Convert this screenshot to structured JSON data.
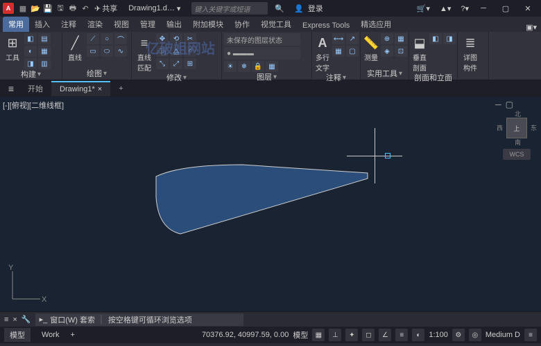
{
  "titlebar": {
    "app_letter": "A",
    "share": "共享",
    "doc_title": "Drawing1.d…",
    "search_placeholder": "键入关键字或短语",
    "login": "登录"
  },
  "ribbon_tabs": [
    "常用",
    "插入",
    "注释",
    "渲染",
    "视图",
    "管理",
    "输出",
    "附加模块",
    "协作",
    "视觉工具",
    "Express Tools",
    "精选应用"
  ],
  "panels": {
    "p0": {
      "label": "构建",
      "btn1": "工具",
      "btn2": ""
    },
    "p1": {
      "label": "绘图",
      "btn": "直线"
    },
    "p2": {
      "label": "修改",
      "btn": "直线\n匹配"
    },
    "p3": {
      "label": "图层",
      "combo": "未保存的图层状态"
    },
    "p4": {
      "label": "注释",
      "btn": "多行\n文字"
    },
    "p5": {
      "label": "实用工具",
      "btn": "测量"
    },
    "p6": {
      "label": "剖面和立面",
      "btn": "垂直\n剖面"
    },
    "p7": {
      "label": "详图\n构件"
    }
  },
  "doctabs": {
    "start": "开始",
    "active": "Drawing1*"
  },
  "viewport": {
    "label": "[-][俯视][二维线框]",
    "cube": {
      "n": "北",
      "s": "南",
      "e": "东",
      "w": "西",
      "top": "上"
    },
    "wcs": "WCS",
    "y": "Y",
    "x": "X"
  },
  "cmdline": {
    "prefix": "窗口(W) 套索",
    "hint": "按空格键可循环浏览选项"
  },
  "statusbar": {
    "model": "模型",
    "work": "Work",
    "coords": "70376.92, 40997.59, 0.00",
    "model2": "模型",
    "scale": "1:100",
    "medium": "Medium D"
  },
  "watermark": "亿破姐网站"
}
